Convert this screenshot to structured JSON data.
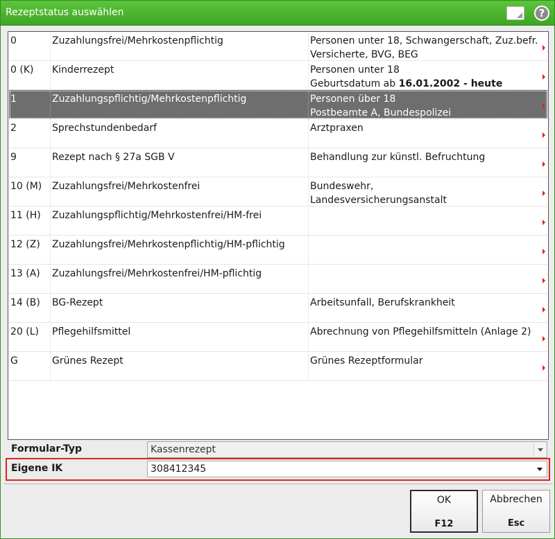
{
  "window": {
    "title": "Rezeptstatus auswählen"
  },
  "list": {
    "rows": [
      {
        "code": "0",
        "name": "Zuzahlungsfrei/Mehrkostenpflichtig",
        "desc1": "Personen unter 18, Schwangerschaft, Zuz.befr.",
        "desc2": "Versicherte, BVG, BEG"
      },
      {
        "code": "0 (K)",
        "name": "Kinderrezept",
        "desc1": "Personen unter 18",
        "desc2_prefix": "Geburtsdatum ab ",
        "desc2_bold": "16.01.2002 - heute"
      },
      {
        "code": "1",
        "name": "Zuzahlungspflichtig/Mehrkostenpflichtig",
        "desc1": "Personen über 18",
        "desc2": "Postbeamte A, Bundespolizei",
        "selected": true
      },
      {
        "code": "2",
        "name": "Sprechstundenbedarf",
        "desc1": "Arztpraxen",
        "desc2": ""
      },
      {
        "code": "9",
        "name": "Rezept nach § 27a SGB V",
        "desc1": "Behandlung zur künstl. Befruchtung",
        "desc2": ""
      },
      {
        "code": "10 (M)",
        "name": "Zuzahlungsfrei/Mehrkostenfrei",
        "desc1": "Bundeswehr,",
        "desc2": "Landesversicherungsanstalt"
      },
      {
        "code": "11 (H)",
        "name": "Zuzahlungspflichtig/Mehrkostenfrei/HM-frei",
        "desc1": "",
        "desc2": ""
      },
      {
        "code": "12 (Z)",
        "name": "Zuzahlungsfrei/Mehrkostenpflichtig/HM-pflichtig",
        "desc1": "",
        "desc2": ""
      },
      {
        "code": "13 (A)",
        "name": "Zuzahlungsfrei/Mehrkostenfrei/HM-pflichtig",
        "desc1": "",
        "desc2": ""
      },
      {
        "code": "14 (B)",
        "name": "BG-Rezept",
        "desc1": "Arbeitsunfall, Berufskrankheit",
        "desc2": ""
      },
      {
        "code": "20 (L)",
        "name": "Pflegehilfsmittel",
        "desc1": "Abrechnung von Pflegehilfsmitteln (Anlage 2)",
        "desc2": ""
      },
      {
        "code": "G",
        "name": "Grünes Rezept",
        "desc1": "Grünes Rezeptformular",
        "desc2": ""
      }
    ]
  },
  "form": {
    "formular_typ_label": "Formular-Typ",
    "formular_typ_value": "Kassenrezept",
    "eigene_ik_label": "Eigene IK",
    "eigene_ik_value": "308412345"
  },
  "buttons": {
    "ok_label": "OK",
    "ok_key": "F12",
    "cancel_label": "Abbrechen",
    "cancel_key": "Esc"
  },
  "colors": {
    "titlebar": "#4cb82f",
    "selected_row": "#6e6e6e",
    "highlight_border": "#e0231c",
    "row_marker": "#d8241c"
  },
  "icons": {
    "titlebar_note": "note-icon",
    "titlebar_help": "help-icon",
    "dropdown": "chevron-down-icon",
    "row_marker": "triangle-right-icon"
  }
}
